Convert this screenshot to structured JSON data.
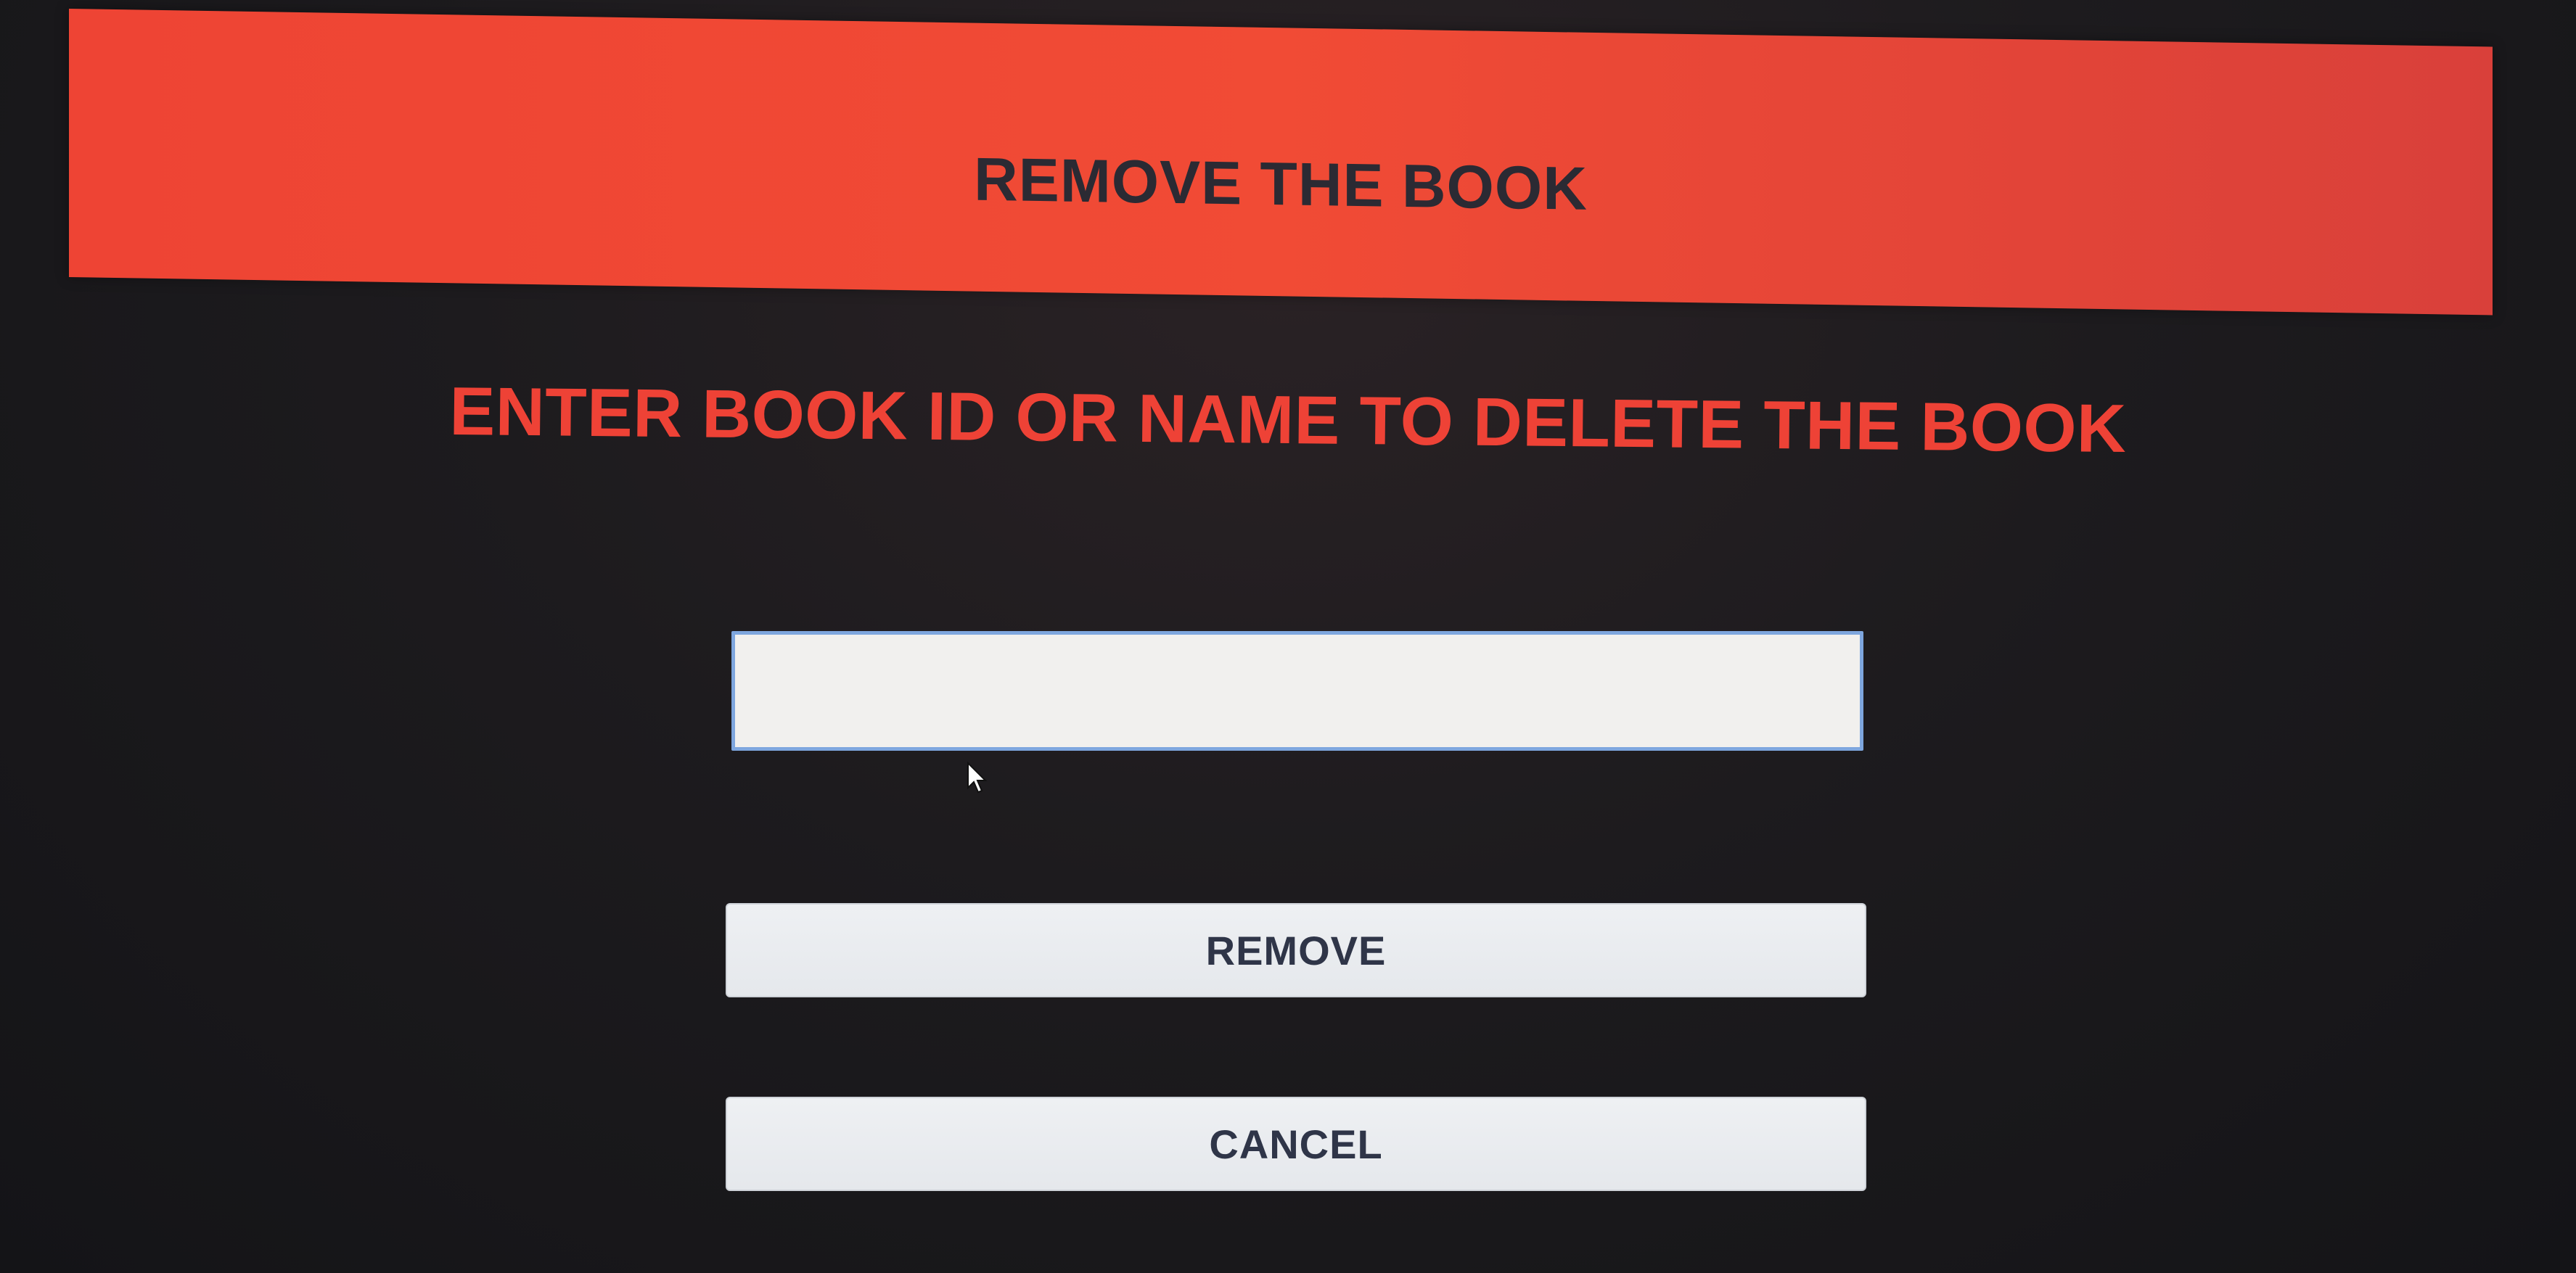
{
  "header": {
    "title": "REMOVE THE BOOK",
    "color": "#f14b35"
  },
  "instruction": {
    "text": "ENTER BOOK ID OR NAME TO DELETE THE BOOK",
    "color": "#ee4236"
  },
  "book_input": {
    "value": "",
    "placeholder": ""
  },
  "buttons": {
    "remove_label": "REMOVE",
    "cancel_label": "CANCEL"
  },
  "icons": {
    "cursor": "mouse-pointer-icon"
  }
}
